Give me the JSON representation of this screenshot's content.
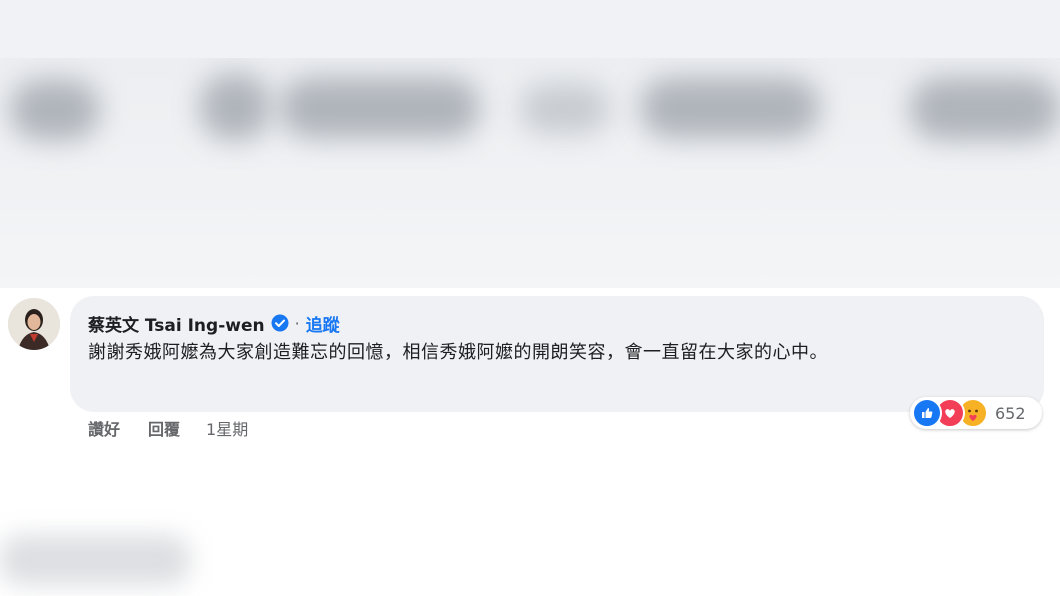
{
  "comment": {
    "author": "蔡英文 Tsai Ing-wen",
    "separator": "·",
    "follow_label": "追蹤",
    "text": "謝謝秀娥阿嬤為大家創造難忘的回憶，相信秀娥阿嬤的開朗笑容，會一直留在大家的心中。",
    "verified_icon": "verified-badge-icon"
  },
  "actions": {
    "like_label": "讚好",
    "reply_label": "回覆",
    "time": "1星期"
  },
  "reactions": {
    "icons": [
      "like-reaction-icon",
      "love-reaction-icon",
      "care-reaction-icon"
    ],
    "count": "652"
  },
  "colors": {
    "accent": "#1877f2",
    "bubble": "#eff1f4",
    "text": "#1c1e21",
    "secondary_text": "#65676b"
  }
}
